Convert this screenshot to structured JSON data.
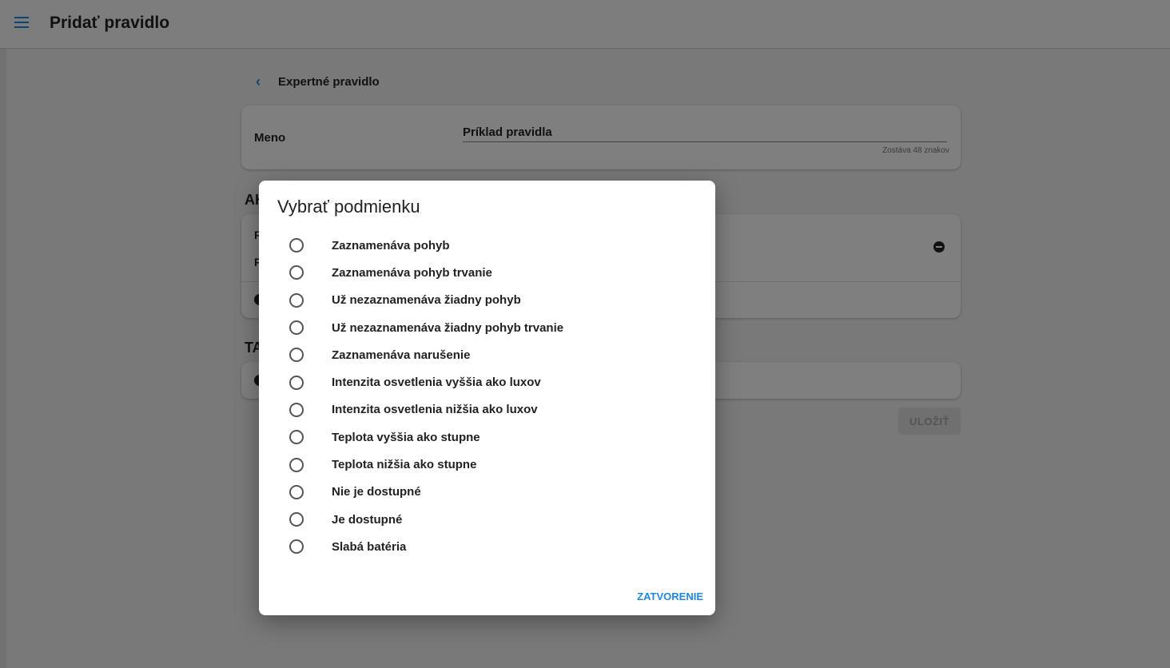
{
  "header": {
    "title": "Pridať pravidlo",
    "menu_icon": "hamburger-menu-icon"
  },
  "breadcrumb": {
    "back_icon": "chevron-left-icon",
    "label": "Expertné pravidlo"
  },
  "rule_form": {
    "name_label": "Meno",
    "name_value": "Príklad pravidla",
    "chars_remaining": "Zostáva 48 znakov",
    "if_section_heading": "AK",
    "if_row_a_text": "F",
    "if_row_b_text": "F",
    "then_section_heading": "TA",
    "save_label": "ULOŽIŤ"
  },
  "dialog": {
    "title": "Vybrať podmienku",
    "options": [
      "Zaznamenáva pohyb",
      "Zaznamenáva pohyb trvanie",
      "Už nezaznamenáva žiadny pohyb",
      "Už nezaznamenáva žiadny pohyb trvanie",
      "Zaznamenáva narušenie",
      "Intenzita osvetlenia vyššia ako luxov",
      "Intenzita osvetlenia nižšia ako luxov",
      "Teplota vyššia ako stupne",
      "Teplota nižšia ako stupne",
      "Nie je dostupné",
      "Je dostupné",
      "Slabá batéria"
    ],
    "close_label": "ZATVORENIE"
  },
  "colors": {
    "accent": "#1e88e5",
    "overlay": "rgba(0,0,0,0.5)",
    "disabled_button": "#e0e0e0"
  }
}
